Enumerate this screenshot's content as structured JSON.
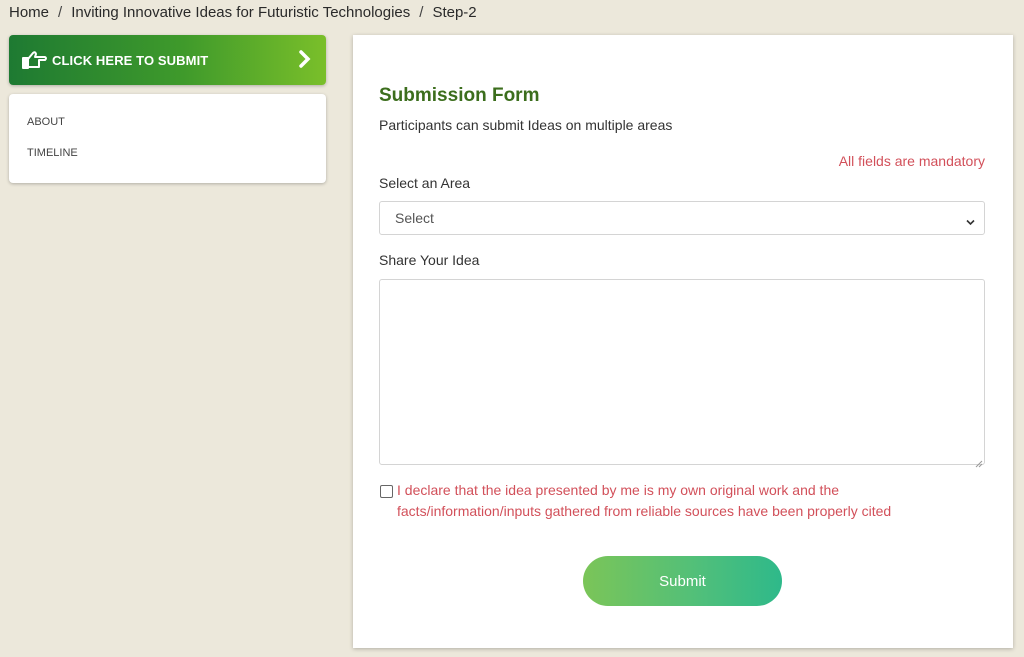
{
  "breadcrumb": {
    "items": [
      "Home",
      "Inviting Innovative Ideas for Futuristic Technologies",
      "Step-2"
    ],
    "separator": "/"
  },
  "sidebar": {
    "submit_banner": {
      "label": "CLICK HERE TO SUBMIT",
      "icon": "hand-pointing-icon",
      "chevron": "chevron-right-icon"
    },
    "items": [
      {
        "label": "ABOUT"
      },
      {
        "label": "TIMELINE"
      }
    ]
  },
  "form": {
    "title": "Submission Form",
    "subtitle": "Participants can submit Ideas on multiple areas",
    "mandatory_note": "All fields are mandatory",
    "area_label": "Select an Area",
    "area_value": "Select",
    "idea_label": "Share Your Idea",
    "idea_value": "",
    "declaration": "I declare that the idea presented by me is my own original work and the facts/information/inputs gathered from reliable sources have been properly cited",
    "declaration_checked": false,
    "submit_label": "Submit"
  },
  "colors": {
    "background": "#ece8db",
    "title_green": "#3c6e1d",
    "warning_red": "#d2505a",
    "banner_gradient": [
      "#1e7a32",
      "#7abf2a"
    ],
    "submit_gradient": [
      "#7bc558",
      "#2eb98a"
    ]
  }
}
